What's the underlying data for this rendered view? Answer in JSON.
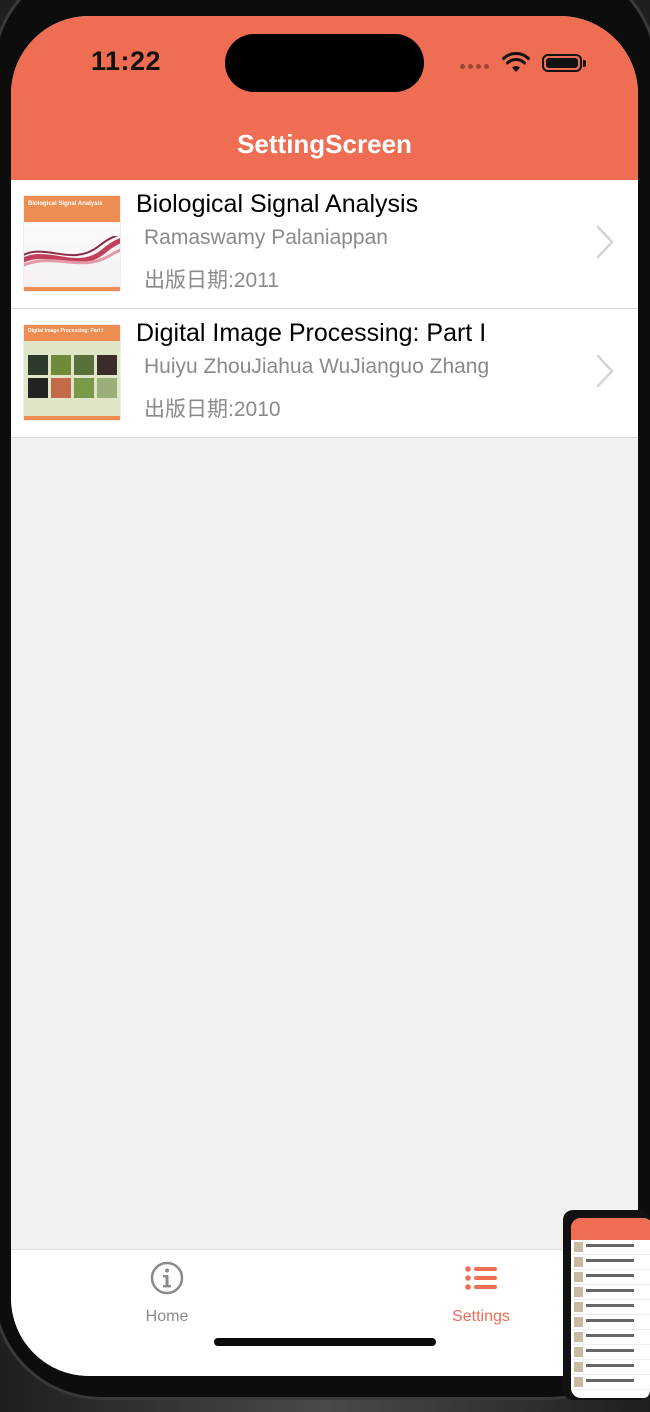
{
  "status_bar": {
    "time": "11:22"
  },
  "nav": {
    "title": "SettingScreen"
  },
  "books": [
    {
      "title": "Biological Signal Analysis",
      "author": "Ramaswamy Palaniappan",
      "date": "出版日期:2011",
      "cover_text": "Biological Signal Analysis"
    },
    {
      "title": "Digital Image Processing: Part I",
      "author": "Huiyu ZhouJiahua WuJianguo Zhang",
      "date": "出版日期:2010",
      "cover_text": "Digital Image Processing: Part I"
    }
  ],
  "tabbar": {
    "home_label": "Home",
    "settings_label": "Settings",
    "home_icon": "info-circle-icon",
    "settings_icon": "list-icon"
  },
  "colors": {
    "header": "#ef6e53",
    "active_tab": "#ef6e53",
    "inactive_tab": "#8a8a8a"
  }
}
